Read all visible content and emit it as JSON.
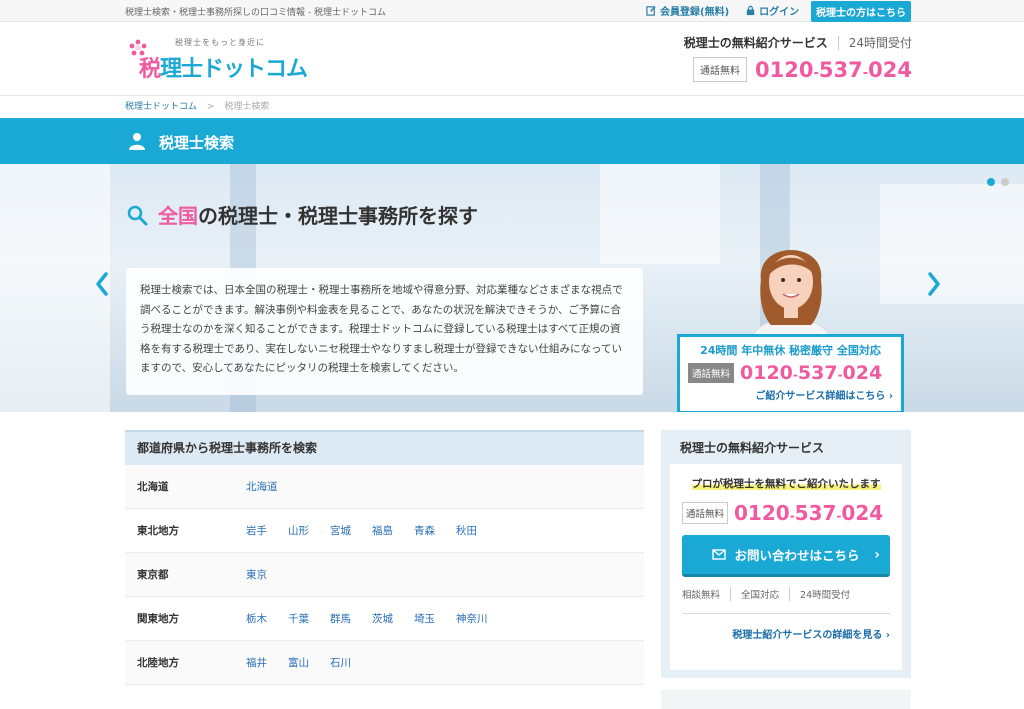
{
  "topbar": {
    "tagline": "税理士検索・税理士事務所探しの口コミ情報 - 税理士ドットコム",
    "register": "会員登録(無料)",
    "login": "ログイン",
    "pro": "税理士の方はこちら"
  },
  "header": {
    "logo_sub": "税理士をもっと身近に",
    "logo_main_pink": "税",
    "logo_main_rest": "理士ドットコム",
    "service": "税理士の無料紹介サービス",
    "hours": "24時間受付",
    "tsuwa": "通話無料",
    "phone": [
      "0120",
      "537",
      "024"
    ]
  },
  "breadcrumb": {
    "home": "税理士ドットコム",
    "current": "税理士検索"
  },
  "titlebar": {
    "title": "税理士検索"
  },
  "hero": {
    "heading_pink": "全国",
    "heading_rest": "の税理士・税理士事務所を探す",
    "body": "税理士検索では、日本全国の税理士・税理士事務所を地域や得意分野、対応業種などさまざまな視点で調べることができます。解決事例や料金表を見ることで、あなたの状況を解決できそうか、ご予算に合う税理士なのかを深く知ることができます。税理士ドットコムに登録している税理士はすべて正規の資格を有する税理士であり、実在しないニセ税理士やなりすまし税理士が登録できない仕組みになっていますので、安心してあなたにピッタリの税理士を検索してください。",
    "ad_features": "24時間 年中無休 秘密厳守 全国対応",
    "ad_tsuwa": "通話無料",
    "ad_more": "ご紹介サービス詳細はこちら"
  },
  "prefecture": {
    "heading": "都道府県から税理士事務所を検索",
    "rows": [
      {
        "region": "北海道",
        "prefs": [
          "北海道"
        ]
      },
      {
        "region": "東北地方",
        "prefs": [
          "岩手",
          "山形",
          "宮城",
          "福島",
          "青森",
          "秋田"
        ]
      },
      {
        "region": "東京都",
        "prefs": [
          "東京"
        ]
      },
      {
        "region": "関東地方",
        "prefs": [
          "栃木",
          "千葉",
          "群馬",
          "茨城",
          "埼玉",
          "神奈川"
        ]
      },
      {
        "region": "北陸地方",
        "prefs": [
          "福井",
          "富山",
          "石川"
        ]
      },
      {
        "region": "",
        "prefs": []
      }
    ]
  },
  "service_panel": {
    "title": "税理士の無料紹介サービス",
    "tag": "プロが税理士を無料でご紹介いたします",
    "tsuwa": "通話無料",
    "contact_button": "お問い合わせはこちら",
    "meta": [
      "相談無料",
      "全国対応",
      "24時間受付"
    ],
    "detail_link": "税理士紹介サービスの詳細を見る"
  },
  "colors": {
    "accent": "#1aa9d4",
    "pink": "#f05aa0",
    "link": "#2a6fb8"
  }
}
